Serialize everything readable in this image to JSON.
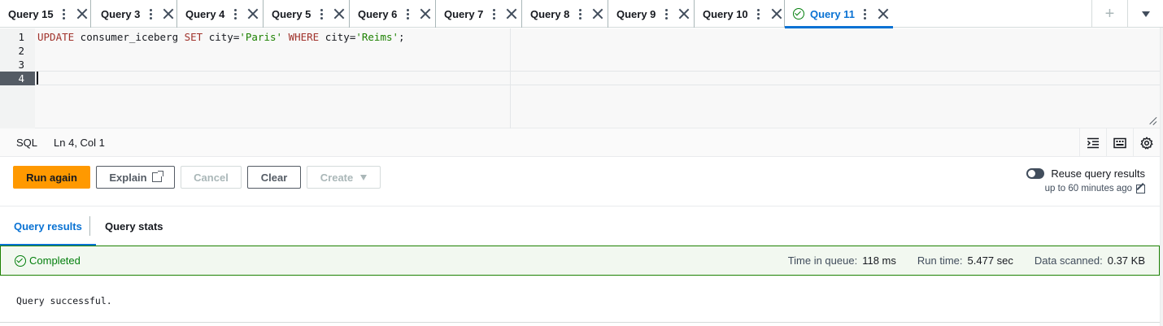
{
  "tabs": [
    {
      "label": "Query 15",
      "active": false
    },
    {
      "label": "Query 3",
      "active": false
    },
    {
      "label": "Query 4",
      "active": false
    },
    {
      "label": "Query 5",
      "active": false
    },
    {
      "label": "Query 6",
      "active": false
    },
    {
      "label": "Query 7",
      "active": false
    },
    {
      "label": "Query 8",
      "active": false
    },
    {
      "label": "Query 9",
      "active": false
    },
    {
      "label": "Query 10",
      "active": false
    },
    {
      "label": "Query 11",
      "active": true,
      "status": "completed"
    }
  ],
  "tab_actions": {
    "add_label": "+",
    "menu_icon": "caret-down-icon"
  },
  "editor": {
    "line_numbers": [
      "1",
      "2",
      "3",
      "4"
    ],
    "active_line": "4",
    "code": {
      "kw1": "UPDATE",
      "tbl": " consumer_iceberg ",
      "kw2": "SET",
      "col1": " city=",
      "val1": "'Paris'",
      "kw3": " WHERE",
      "col2": " city=",
      "val2": "'Reims'",
      "end": ";"
    }
  },
  "status_bar": {
    "language": "SQL",
    "cursor": "Ln 4, Col 1"
  },
  "actions": {
    "run_again": "Run again",
    "explain": "Explain",
    "cancel": "Cancel",
    "clear": "Clear",
    "create": "Create"
  },
  "reuse": {
    "label": "Reuse query results",
    "sub": "up to 60 minutes ago",
    "enabled": false
  },
  "result_tabs": {
    "results": "Query results",
    "stats": "Query stats"
  },
  "banner": {
    "status": "Completed",
    "time_in_queue_label": "Time in queue:",
    "time_in_queue": "118 ms",
    "run_time_label": "Run time:",
    "run_time": "5.477 sec",
    "data_scanned_label": "Data scanned:",
    "data_scanned": "0.37 KB"
  },
  "result_message": "Query successful.",
  "colors": {
    "primary": "#ff9900",
    "link": "#0972d3",
    "success": "#037f0c"
  }
}
